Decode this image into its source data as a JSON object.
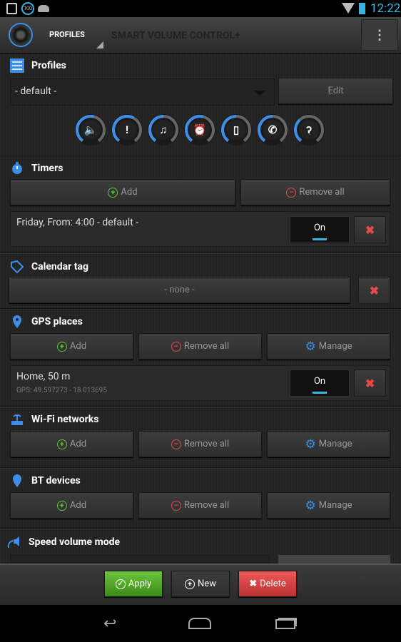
{
  "status_bar": {
    "time": "12:22",
    "badge": "100"
  },
  "action_bar": {
    "nav_label": "PROFILES",
    "title": "SMART VOLUME CONTROL+"
  },
  "profiles": {
    "title": "Profiles",
    "selected": "- default -",
    "edit_label": "Edit",
    "volumes": [
      {
        "icon": "speaker-icon",
        "level": 0.55
      },
      {
        "icon": "notification-icon",
        "level": 0.6
      },
      {
        "icon": "music-icon",
        "level": 0.5
      },
      {
        "icon": "alarm-icon",
        "level": 0.55
      },
      {
        "icon": "phone-device-icon",
        "level": 0.5
      },
      {
        "icon": "call-icon",
        "level": 0.5
      },
      {
        "icon": "hearing-icon",
        "level": 0.35
      }
    ]
  },
  "timers": {
    "title": "Timers",
    "add": "Add",
    "remove_all": "Remove all",
    "items": [
      {
        "text": "Friday, From: 4:00 - default -",
        "state": "On"
      }
    ]
  },
  "calendar": {
    "title": "Calendar tag",
    "value": "- none -"
  },
  "gps": {
    "title": "GPS places",
    "add": "Add",
    "remove_all": "Remove all",
    "manage": "Manage",
    "items": [
      {
        "name": "Home, 50 m",
        "coords": "GPS: 49.597273 - 18.013695",
        "state": "On"
      }
    ]
  },
  "wifi": {
    "title": "Wi-Fi networks",
    "add": "Add",
    "remove_all": "Remove all",
    "manage": "Manage"
  },
  "bt": {
    "title": "BT devices",
    "add": "Add",
    "remove_all": "Remove all",
    "manage": "Manage"
  },
  "speed": {
    "title": "Speed volume mode"
  },
  "bottom": {
    "apply": "Apply",
    "new": "New",
    "delete": "Delete"
  },
  "colors": {
    "accent": "#33b5e5",
    "icon_blue": "#3d8ee8",
    "apply": "#4a9a22",
    "delete": "#d84040",
    "add": "#5cc23a",
    "remove": "#e84848"
  }
}
